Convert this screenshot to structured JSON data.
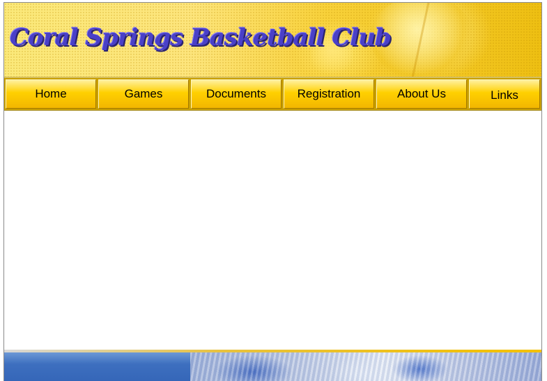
{
  "site": {
    "title": "Coral Springs Basketball Club"
  },
  "nav": {
    "items": [
      {
        "label": "Home"
      },
      {
        "label": "Games"
      },
      {
        "label": "Documents"
      },
      {
        "label": "Registration"
      },
      {
        "label": "About Us"
      },
      {
        "label": "Links"
      }
    ]
  },
  "colors": {
    "header_yellow": "#f8d13a",
    "title_blue": "#4a40c8",
    "nav_gold": "#ffd000",
    "footer_blue": "#3d6fbf"
  }
}
